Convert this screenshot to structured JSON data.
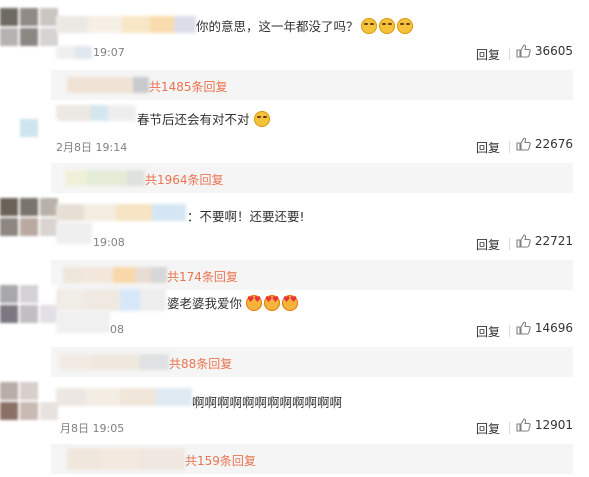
{
  "colors": {
    "link": "#eb7350",
    "time": "#808080",
    "text": "#333333",
    "sub_bg": "#f5f5f5"
  },
  "comments": [
    {
      "text": "你的意思，这一年都没了吗？",
      "emoji": [
        "yellow-face-icon",
        "yellow-face-icon",
        "yellow-face-icon"
      ],
      "time": "19:07",
      "reply": "回复",
      "likes": "36605",
      "sub_replies": "共1485条回复"
    },
    {
      "text": "春节后还会有对不对",
      "emoji": [
        "yellow-face-icon"
      ],
      "time": "2月8日 19:14",
      "reply": "回复",
      "likes": "22676",
      "sub_replies": "共1964条回复"
    },
    {
      "text": "：不要啊！还要还要!",
      "emoji": [],
      "time": "19:08",
      "reply": "回复",
      "likes": "22721",
      "sub_replies": "共174条回复"
    },
    {
      "text": "婆老婆我爱你",
      "emoji": [
        "heart-eyes-icon",
        "heart-eyes-icon",
        "heart-eyes-icon"
      ],
      "time": "08",
      "reply": "回复",
      "likes": "14696",
      "sub_replies": "共88条回复"
    },
    {
      "text": "啊啊啊啊啊啊啊啊啊啊啊啊",
      "emoji": [],
      "time": "月8日 19:05",
      "reply": "回复",
      "likes": "12901",
      "sub_replies": "共159条回复"
    }
  ]
}
